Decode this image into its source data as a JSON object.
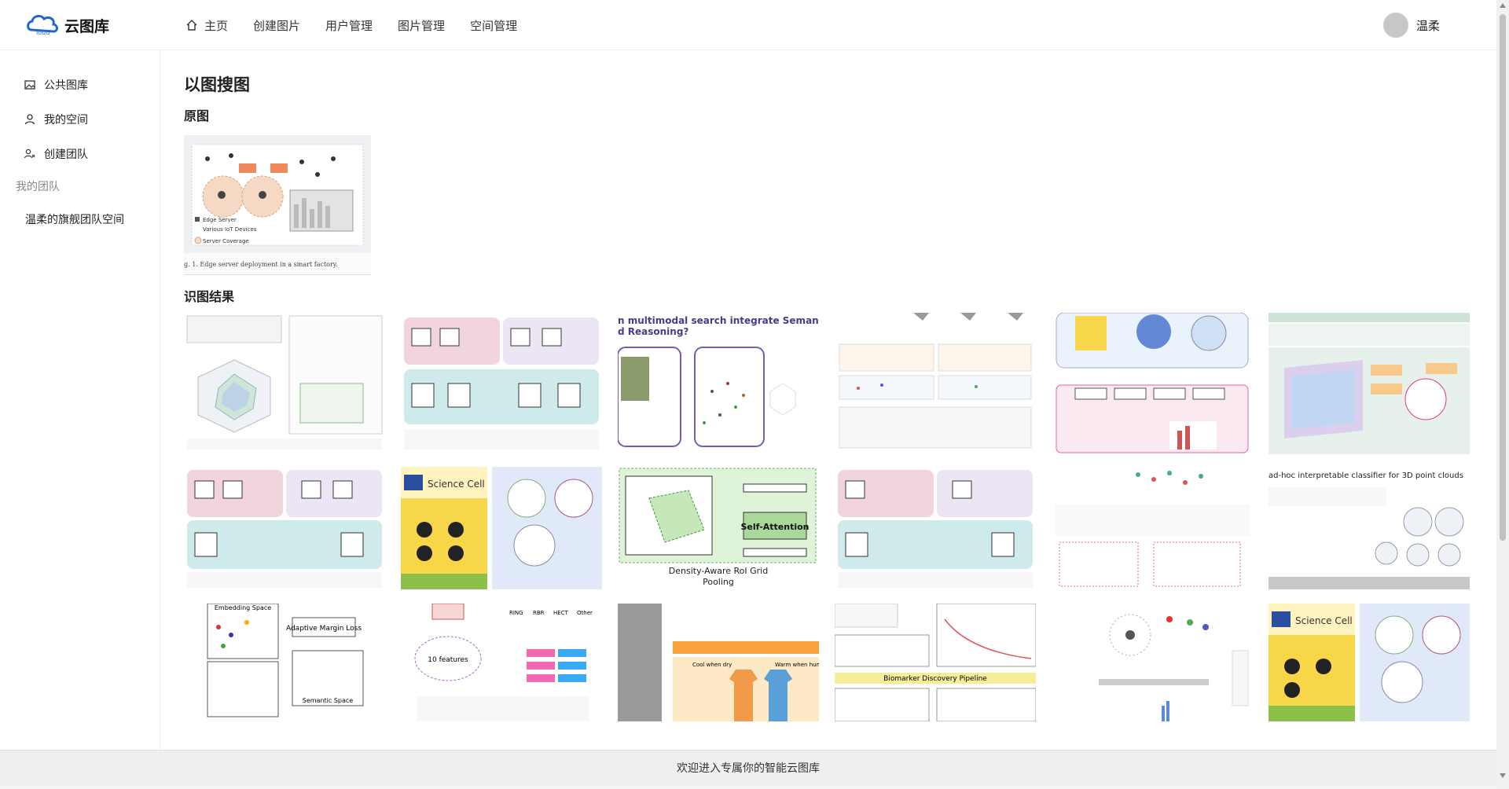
{
  "app": {
    "title": "云图库"
  },
  "nav": [
    {
      "label": "主页",
      "icon": "home-icon"
    },
    {
      "label": "创建图片"
    },
    {
      "label": "用户管理"
    },
    {
      "label": "图片管理"
    },
    {
      "label": "空间管理"
    }
  ],
  "user": {
    "name": "温柔"
  },
  "sidebar": {
    "items": [
      {
        "label": "公共图库",
        "icon": "picture-icon"
      },
      {
        "label": "我的空间",
        "icon": "user-icon"
      },
      {
        "label": "创建团队",
        "icon": "team-icon"
      }
    ],
    "group_label": "我的团队",
    "teams": [
      {
        "label": "温柔的旗舰团队空间"
      }
    ]
  },
  "main": {
    "title": "以图搜图",
    "original_label": "原图",
    "original_caption": "g. 1.   Edge server deployment in a smart factory.",
    "original_legend": [
      "Edge Server",
      "Various IoT Devices",
      "Server Coverage"
    ],
    "results_label": "识图结果"
  },
  "results_text": {
    "r1c3_title_line1": "n multimodal search integrate Semantics",
    "r1c3_title_line2": "d Reasoning?",
    "r2c2_source": "Science Cell",
    "r2c3_label": "Self-Attention",
    "r2c3_caption_line1": "Density-Aware RoI Grid",
    "r2c3_caption_line2": "Pooling",
    "r2c6_title": "ad-hoc interpretable classifier for 3D point clouds",
    "r3c1_top": "Embedding Space",
    "r3c1_box": "Adaptive Margin Loss",
    "r3c1_bottom": "Semantic Space",
    "r3c2_center": "10 features",
    "r3c2_heads": [
      "RING",
      "RBR",
      "HECT",
      "Other"
    ],
    "r3c3_labels": [
      "Cool when dry",
      "Warm when humid"
    ],
    "r3c4_title": "Biomarker Discovery Pipeline",
    "r3c6_source": "Science Cell"
  },
  "footer": {
    "text": "欢迎进入专属你的智能云图库"
  },
  "colors": {
    "accent": "#1f66d6",
    "pink": "#f2d4dc",
    "teal": "#cfeaea",
    "green": "#dff3d8",
    "yellow": "#f7d64a"
  }
}
